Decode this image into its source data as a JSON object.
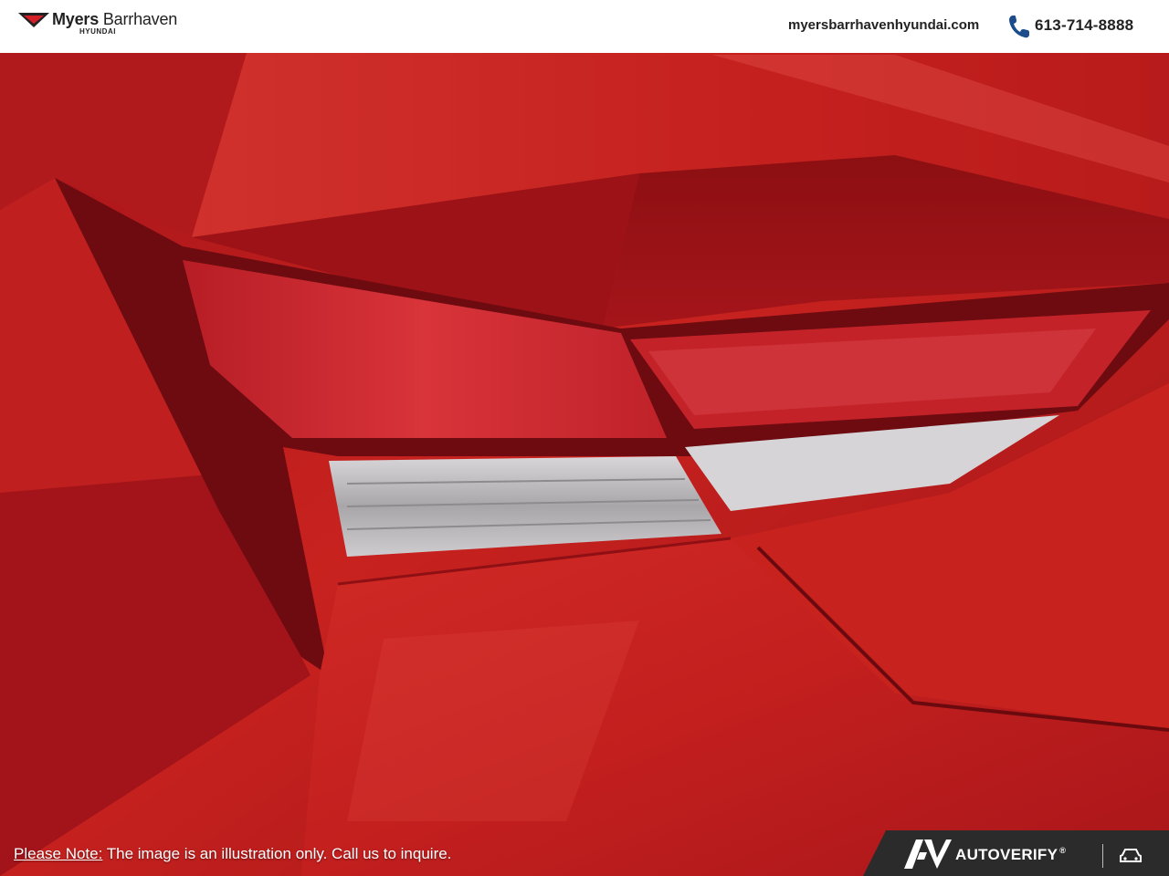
{
  "header": {
    "brand_name_bold": "Myers",
    "brand_name_light": "Barrhaven",
    "brand_sub": "HYUNDAI",
    "website": "myersbarrhavenhyundai.com",
    "phone": "613-714-8888",
    "phone_icon": "phone-icon",
    "logo_icon": "myers-logo-icon"
  },
  "photo": {
    "subject": "car-taillight-photo"
  },
  "footer": {
    "note_label": "Please Note:",
    "note_text": " The image is an illustration only. Call us to inquire.",
    "badge_text": "AUTOVERIFY",
    "badge_reg": "®",
    "badge_icon": "autoverify-logo-icon",
    "car_icon": "car-icon"
  },
  "colors": {
    "paint": "#c8221f",
    "paint_dark": "#7a0c0e",
    "lamp_red": "#d4272e",
    "lamp_clear": "#b9b6b8",
    "header_bg": "#ffffff",
    "header_text": "#222222",
    "badge_bg": "#2b2b2b"
  }
}
